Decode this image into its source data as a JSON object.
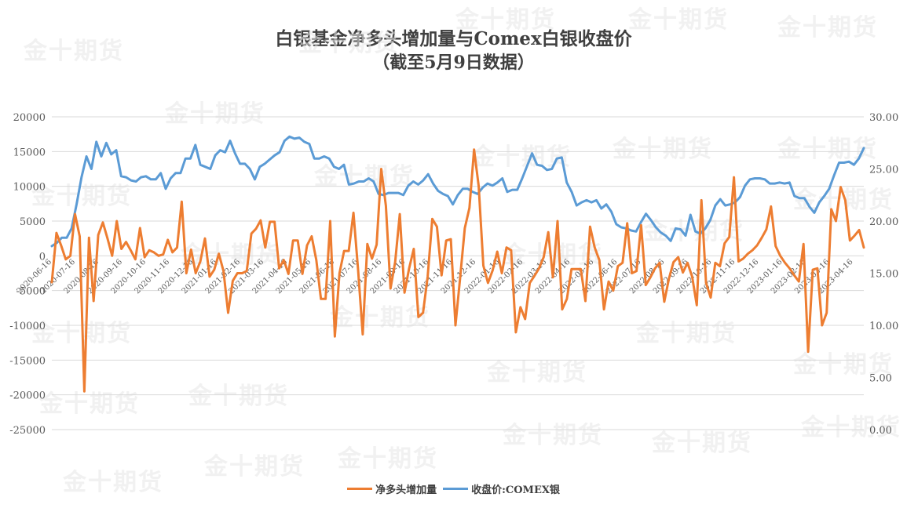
{
  "chart_data": {
    "type": "line",
    "title": "白银基金净多头增加量与Comex白银收盘价",
    "subtitle": "（截至5月9日数据）",
    "xlabel": "",
    "ylabel_left": "",
    "ylabel_right": "",
    "ylim_left": [
      -25000,
      20000
    ],
    "ylim_right": [
      0,
      30
    ],
    "yticks_left": [
      "20000",
      "15000",
      "10000",
      "5000",
      "0",
      "-5000",
      "-10000",
      "-15000",
      "-20000",
      "-25000"
    ],
    "yticks_right": [
      "30.00",
      "25.00",
      "20.00",
      "15.00",
      "10.00",
      "5.00",
      "0.00"
    ],
    "xtick_labels": [
      "2020-06-16",
      "2020-07-16",
      "2020-08-16",
      "2020-09-16",
      "2020-10-16",
      "2020-11-16",
      "2020-12-16",
      "2021-01-16",
      "2021-02-16",
      "2021-03-16",
      "2021-04-16",
      "2021-05-16",
      "2021-06-16",
      "2021-07-16",
      "2021-08-16",
      "2021-09-16",
      "2021-10-16",
      "2021-11-16",
      "2021-12-16",
      "2022-01-16",
      "2022-02-16",
      "2022-03-16",
      "2022-04-16",
      "2022-05-16",
      "2022-06-16",
      "2022-07-16",
      "2022-08-16",
      "2022-09-16",
      "2022-10-16",
      "2022-11-16",
      "2022-12-16",
      "2023-01-16",
      "2023-02-16",
      "2023-03-16",
      "2023-04-16"
    ],
    "grid": true,
    "legend_position": "bottom",
    "series": [
      {
        "name": "净多头增加量",
        "axis": "left",
        "color": "#ED7D31",
        "values": [
          -3800,
          3300,
          1500,
          -500,
          0,
          6000,
          2800,
          -19500,
          2600,
          -6500,
          3000,
          4800,
          2500,
          0,
          5000,
          1000,
          2000,
          800,
          -500,
          4000,
          -200,
          800,
          500,
          0,
          200,
          2300,
          500,
          1200,
          7800,
          -2500,
          900,
          -2500,
          -800,
          2500,
          -3000,
          -2000,
          300,
          -2200,
          -8200,
          -3600,
          -2500,
          -2500,
          -2200,
          3200,
          3900,
          5100,
          1200,
          4900,
          4900,
          -1800,
          -600,
          -2600,
          2200,
          2200,
          -2600,
          1500,
          2800,
          -600,
          -6200,
          -6200,
          5000,
          -11600,
          -2500,
          700,
          700,
          6200,
          -2000,
          -11300,
          1700,
          -400,
          1600,
          12500,
          7200,
          -4700,
          -900,
          6000,
          -5300,
          -1800,
          1000,
          -8800,
          -8200,
          -3000,
          5300,
          4200,
          -2800,
          2200,
          2400,
          -10000,
          -3100,
          4000,
          6900,
          15300,
          10000,
          -1400,
          -3900,
          -2100,
          600,
          -2500,
          1200,
          800,
          -11000,
          -7400,
          -9100,
          -3900,
          -2900,
          -1800,
          -200,
          3400,
          -3100,
          5000,
          -7700,
          -6200,
          -1900,
          -1900,
          -1900,
          -6500,
          4200,
          1200,
          -600,
          -7700,
          -3700,
          -5000,
          -1500,
          -1000,
          4700,
          -2500,
          -2200,
          4400,
          -4200,
          -3100,
          -1800,
          -1000,
          -6600,
          -3300,
          -900,
          -200,
          -2400,
          -1000,
          -3000,
          -7100,
          8000,
          -3900,
          -6000,
          -1000,
          -1500,
          1800,
          2700,
          11300,
          -800,
          -400,
          300,
          800,
          1500,
          2600,
          3800,
          7100,
          1400,
          0,
          -1000,
          -1800,
          -2800,
          -3700,
          1700,
          -13800,
          -2000,
          -1800,
          -10000,
          -8200,
          6700,
          5000,
          9900,
          8000,
          2200,
          2900,
          3700,
          1200
        ],
        "note": "weekly estimates read from gridlines; visual approximation"
      },
      {
        "name": "收盘价:COMEX银",
        "axis": "right",
        "color": "#5B9BD5",
        "values": [
          17.6,
          17.9,
          18.4,
          18.4,
          19.3,
          21.6,
          24.2,
          26.2,
          25.0,
          27.6,
          26.2,
          27.5,
          26.4,
          26.8,
          24.3,
          24.2,
          23.9,
          23.8,
          24.2,
          24.3,
          24.0,
          24.0,
          24.6,
          23.1,
          24.1,
          24.6,
          24.6,
          26.0,
          26.0,
          27.3,
          25.4,
          25.2,
          25.0,
          26.3,
          26.8,
          26.6,
          27.7,
          26.5,
          25.5,
          25.5,
          25.0,
          24.0,
          25.2,
          25.5,
          25.9,
          26.3,
          26.6,
          27.7,
          28.1,
          27.9,
          28.0,
          27.6,
          27.4,
          26.0,
          26.0,
          26.2,
          26.0,
          25.2,
          25.0,
          25.4,
          23.5,
          23.6,
          23.8,
          23.8,
          24.1,
          23.8,
          22.6,
          22.5,
          22.7,
          22.7,
          22.7,
          22.5,
          23.4,
          23.8,
          23.5,
          23.9,
          24.5,
          23.6,
          22.9,
          22.6,
          22.4,
          21.6,
          22.5,
          23.1,
          23.1,
          22.8,
          22.6,
          23.2,
          23.6,
          23.4,
          23.7,
          24.1,
          22.8,
          23.0,
          23.0,
          24.1,
          25.3,
          26.5,
          25.4,
          25.3,
          24.9,
          25.0,
          26.0,
          26.1,
          23.7,
          22.8,
          21.5,
          21.8,
          22.0,
          21.8,
          22.0,
          21.2,
          21.6,
          20.9,
          19.7,
          19.4,
          19.3,
          19.1,
          19.0,
          19.9,
          20.7,
          20.1,
          19.4,
          18.9,
          18.6,
          18.1,
          19.3,
          19.2,
          18.6,
          20.6,
          19.0,
          18.8,
          19.3,
          20.1,
          21.5,
          22.1,
          21.5,
          21.6,
          21.8,
          22.3,
          23.4,
          24.0,
          24.1,
          24.1,
          24.0,
          23.6,
          23.6,
          23.7,
          23.6,
          23.7,
          22.4,
          22.2,
          22.2,
          21.4,
          20.8,
          21.8,
          22.4,
          23.1,
          24.4,
          25.6,
          25.6,
          25.7,
          25.4,
          26.0,
          27.0
        ],
        "note": "weekly estimates read from right axis; visual approximation"
      }
    ]
  },
  "watermark_text": "金十期货",
  "legend": {
    "items": [
      {
        "label": "净多头增加量",
        "color": "#ED7D31"
      },
      {
        "label": "收盘价:COMEX银",
        "color": "#5B9BD5"
      }
    ]
  }
}
